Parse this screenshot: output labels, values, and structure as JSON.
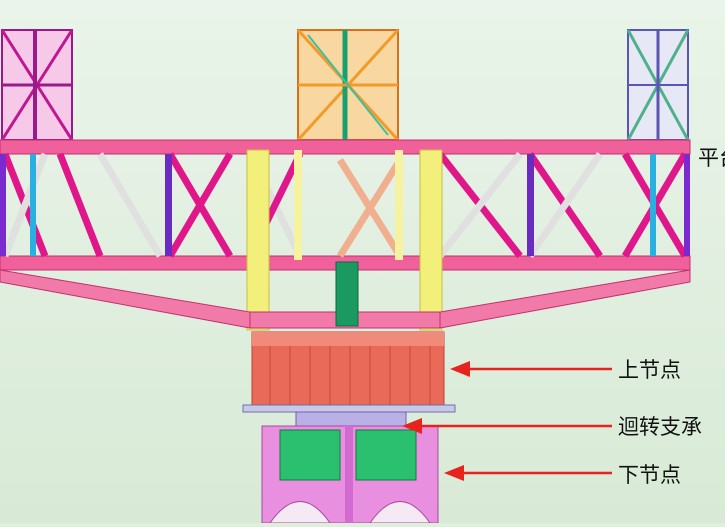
{
  "labels": {
    "platform_partial": "平台",
    "upper_node": "上节点",
    "slewing_bearing": "迴转支承",
    "lower_node": "下节点"
  },
  "colors": {
    "background": "#dfeedd",
    "truss_pink": "#f0609a",
    "truss_magenta": "#e0178a",
    "upper_node": "#ea6a5a",
    "yellow_post": "#f2f07a",
    "lower_node": "#e98fe0",
    "slewing_green": "#1fb36a",
    "arrow_red": "#e8231e"
  }
}
